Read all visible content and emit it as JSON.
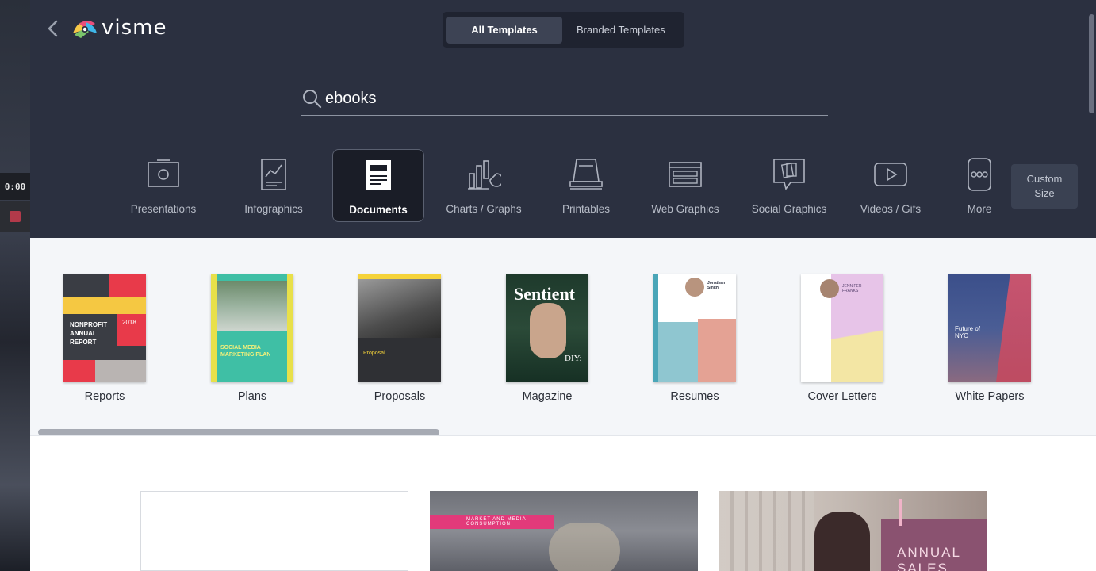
{
  "timer": "0:00",
  "logo_text": "visme",
  "toggle": {
    "all": "All Templates",
    "branded": "Branded Templates"
  },
  "search": {
    "value": "ebooks"
  },
  "categories": [
    {
      "label": "Presentations"
    },
    {
      "label": "Infographics"
    },
    {
      "label": "Documents"
    },
    {
      "label": "Charts / Graphs"
    },
    {
      "label": "Printables"
    },
    {
      "label": "Web Graphics"
    },
    {
      "label": "Social Graphics"
    },
    {
      "label": "Videos / Gifs"
    },
    {
      "label": "More"
    }
  ],
  "custom_size": {
    "line1": "Custom",
    "line2": "Size"
  },
  "subcategories": [
    {
      "label": "Reports",
      "thumb_text": [
        "NONPROFIT",
        "ANNUAL",
        "REPORT"
      ],
      "year": "2018"
    },
    {
      "label": "Plans",
      "thumb_text": [
        "SOCIAL MEDIA",
        "MARKETING PLAN"
      ]
    },
    {
      "label": "Proposals",
      "thumb_text": [
        "Proposal"
      ]
    },
    {
      "label": "Magazine",
      "thumb_text": [
        "Sentient",
        "DIY:"
      ]
    },
    {
      "label": "Resumes",
      "thumb_text": [
        "Jonathan",
        "Smith"
      ]
    },
    {
      "label": "Cover Letters",
      "thumb_text": [
        "JENNIFER",
        "FRANKS"
      ]
    },
    {
      "label": "White Papers",
      "thumb_text": [
        "Future of",
        "NYC"
      ]
    }
  ],
  "cards": {
    "card2_label": "MARKET AND MEDIA CONSUMPTION",
    "card3_title": [
      "ANNUAL",
      "SALES"
    ]
  }
}
